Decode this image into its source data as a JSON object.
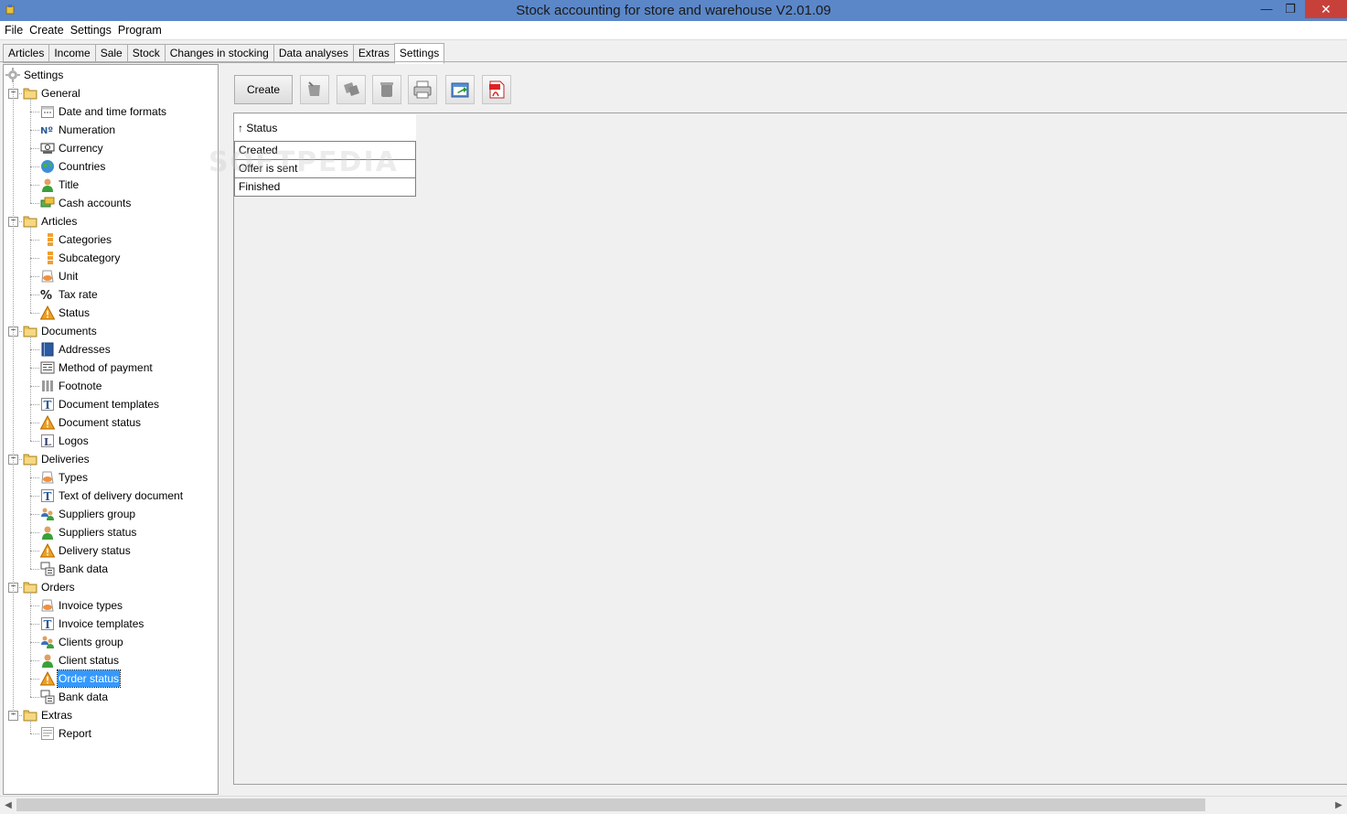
{
  "window": {
    "title": "Stock accounting for store and warehouse V2.01.09",
    "min_glyph": "—",
    "max_glyph": "❐",
    "close_glyph": "✕"
  },
  "menu": [
    "File",
    "Create",
    "Settings",
    "Program"
  ],
  "tabs": [
    {
      "label": "Articles"
    },
    {
      "label": "Income"
    },
    {
      "label": "Sale"
    },
    {
      "label": "Stock"
    },
    {
      "label": "Changes in stocking"
    },
    {
      "label": "Data analyses"
    },
    {
      "label": "Extras"
    },
    {
      "label": "Settings",
      "active": true
    }
  ],
  "tree": {
    "root": "Settings",
    "groups": [
      {
        "label": "General",
        "items": [
          {
            "label": "Date and time formats",
            "icon": "calendar-icon"
          },
          {
            "label": "Numeration",
            "icon": "number-sign-icon"
          },
          {
            "label": "Currency",
            "icon": "currency-icon"
          },
          {
            "label": "Countries",
            "icon": "globe-icon"
          },
          {
            "label": "Title",
            "icon": "person-icon"
          },
          {
            "label": "Cash accounts",
            "icon": "cash-icon"
          }
        ]
      },
      {
        "label": "Articles",
        "items": [
          {
            "label": "Categories",
            "icon": "category-icon"
          },
          {
            "label": "Subcategory",
            "icon": "category-icon"
          },
          {
            "label": "Unit",
            "icon": "unit-icon"
          },
          {
            "label": "Tax rate",
            "icon": "percent-icon"
          },
          {
            "label": "Status",
            "icon": "warning-icon"
          }
        ]
      },
      {
        "label": "Documents",
        "items": [
          {
            "label": "Addresses",
            "icon": "address-book-icon"
          },
          {
            "label": "Method of payment",
            "icon": "payment-icon"
          },
          {
            "label": "Footnote",
            "icon": "footnote-icon"
          },
          {
            "label": "Document templates",
            "icon": "template-icon"
          },
          {
            "label": "Document status",
            "icon": "warning-icon"
          },
          {
            "label": "Logos",
            "icon": "logo-icon"
          }
        ]
      },
      {
        "label": "Deliveries",
        "items": [
          {
            "label": "Types",
            "icon": "unit-icon"
          },
          {
            "label": "Text of delivery document",
            "icon": "template-icon"
          },
          {
            "label": "Suppliers group",
            "icon": "group-icon"
          },
          {
            "label": "Suppliers status",
            "icon": "person-icon"
          },
          {
            "label": "Delivery status",
            "icon": "warning-icon"
          },
          {
            "label": "Bank data",
            "icon": "bank-icon"
          }
        ]
      },
      {
        "label": "Orders",
        "items": [
          {
            "label": "Invoice types",
            "icon": "unit-icon"
          },
          {
            "label": "Invoice templates",
            "icon": "template-icon"
          },
          {
            "label": "Clients group",
            "icon": "group-icon"
          },
          {
            "label": "Client status",
            "icon": "person-icon"
          },
          {
            "label": "Order status",
            "icon": "warning-icon",
            "selected": true
          },
          {
            "label": "Bank data",
            "icon": "bank-icon"
          }
        ]
      },
      {
        "label": "Extras",
        "items": [
          {
            "label": "Report",
            "icon": "report-icon"
          }
        ]
      }
    ]
  },
  "toolbar": {
    "create_label": "Create",
    "tools": [
      "edit-icon",
      "copy-icon",
      "delete-icon",
      "print-icon",
      "export-icon",
      "pdf-icon"
    ]
  },
  "grid": {
    "header": "↑ Status",
    "rows": [
      "Created",
      "Offer is sent",
      "Finished"
    ]
  },
  "watermark": "SOFTPEDIA",
  "colors": {
    "titlebar": "#5b87c9",
    "selection": "#3399ff",
    "close": "#c7413a"
  }
}
